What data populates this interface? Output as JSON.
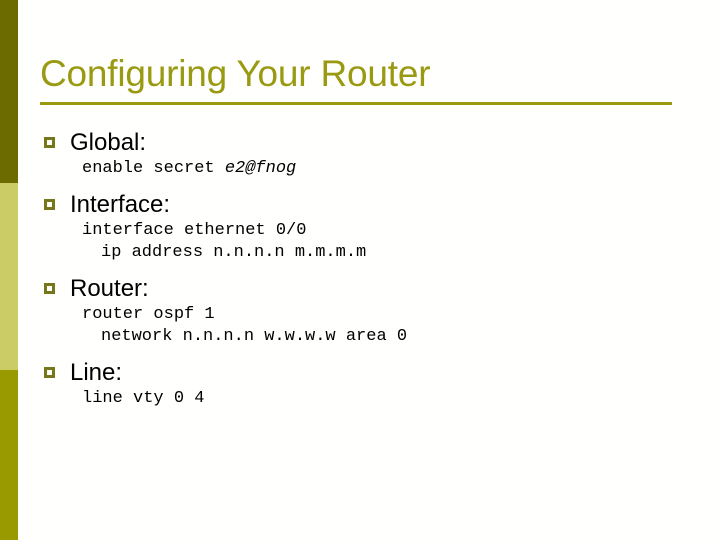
{
  "slide": {
    "title": "Configuring Your Router",
    "colors": {
      "title": "#9a9a12",
      "rule": "#9a9a12",
      "bullet_marker": "#76761a",
      "sidebar_top": "#6b6b00",
      "sidebar_middle": "#cccc66",
      "sidebar_bottom": "#999900",
      "background": "#fffffd",
      "body_text": "#000000"
    },
    "sidebar": {
      "bands": [
        {
          "name": "sidebar-band-top",
          "color": "#6b6b00"
        },
        {
          "name": "sidebar-band-middle",
          "color": "#cccc66"
        },
        {
          "name": "sidebar-band-bottom",
          "color": "#999900"
        }
      ]
    },
    "bullets": [
      {
        "marker": "hollow-square-bullet",
        "heading": "Global:",
        "lines": [
          {
            "indent": 0,
            "text_plain": "enable secret ",
            "text_italic": "e2@fnog"
          }
        ]
      },
      {
        "marker": "hollow-square-bullet",
        "heading": "Interface:",
        "lines": [
          {
            "indent": 0,
            "text_plain": "interface ethernet 0/0",
            "text_italic": ""
          },
          {
            "indent": 1,
            "text_plain": "ip address n.n.n.n m.m.m.m",
            "text_italic": ""
          }
        ]
      },
      {
        "marker": "hollow-square-bullet",
        "heading": "Router:",
        "lines": [
          {
            "indent": 0,
            "text_plain": "router ospf 1",
            "text_italic": ""
          },
          {
            "indent": 1,
            "text_plain": "network n.n.n.n w.w.w.w area 0",
            "text_italic": ""
          }
        ]
      },
      {
        "marker": "hollow-square-bullet",
        "heading": "Line:",
        "lines": [
          {
            "indent": 0,
            "text_plain": "line vty 0 4",
            "text_italic": ""
          }
        ]
      }
    ]
  }
}
